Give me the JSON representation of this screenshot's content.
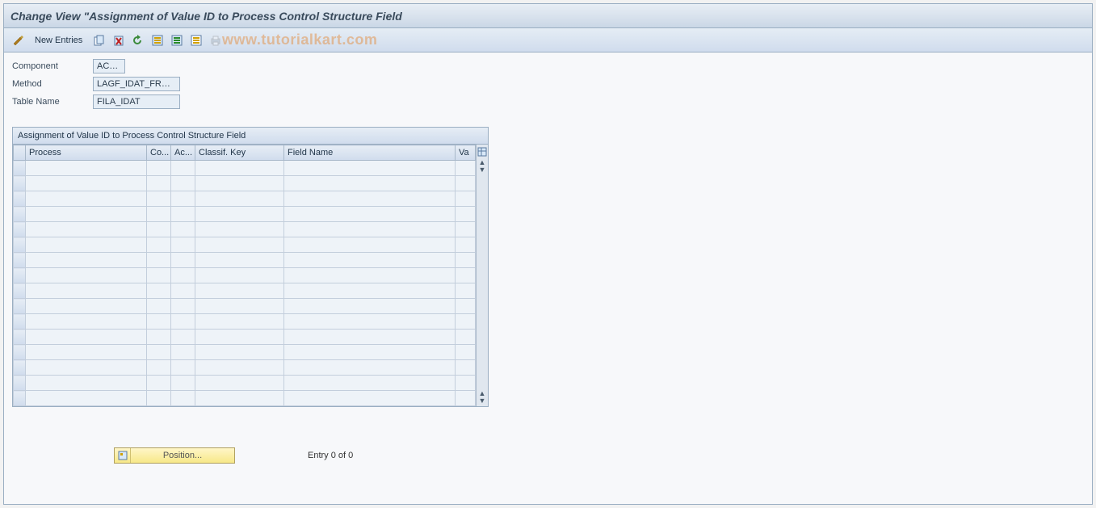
{
  "title": "Change View \"Assignment of Value ID to Process Control Structure Field",
  "toolbar": {
    "new_entries": "New Entries"
  },
  "watermark": "www.tutorialkart.com",
  "fields": {
    "component_label": "Component",
    "component_value": "ACAC",
    "method_label": "Method",
    "method_value": "LAGF_IDAT_FROM…",
    "table_label": "Table Name",
    "table_value": "FILA_IDAT"
  },
  "table": {
    "header": "Assignment of Value ID to Process Control Structure Field",
    "columns": {
      "c1": "Process",
      "c2": "Co...",
      "c3": "Ac...",
      "c4": "Classif. Key",
      "c5": "Field Name",
      "c6": "Va"
    }
  },
  "footer": {
    "position_label": "Position...",
    "entry_text": "Entry 0 of 0"
  }
}
